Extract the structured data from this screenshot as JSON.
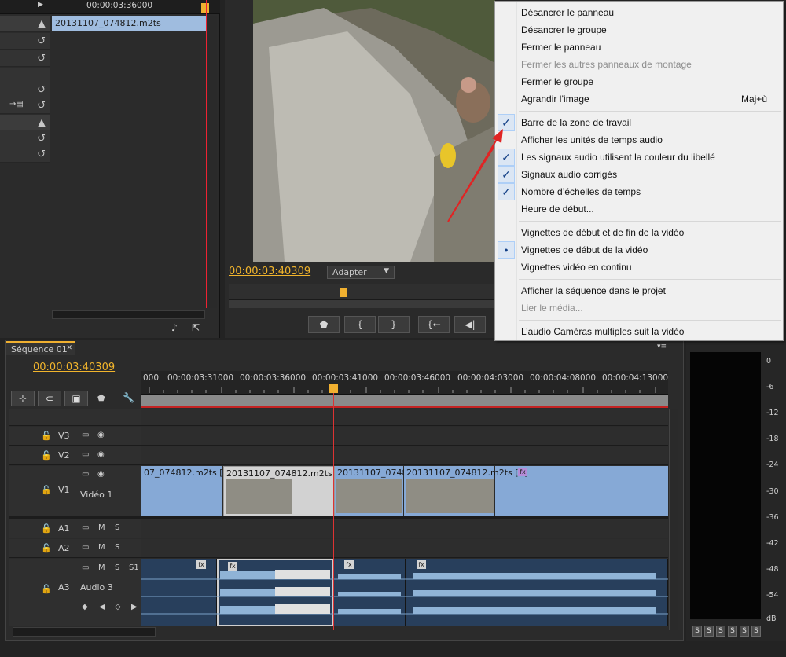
{
  "colors": {
    "accent_timecode": "#f2b52c",
    "video_clip": "#86a9d6",
    "audio_clip": "#283f5c",
    "playhead": "#dd3333"
  },
  "source_panel": {
    "ruler_tc": "00:00:03:36000",
    "clip_name": "20131107_074812.m2ts"
  },
  "program": {
    "timecode": "00:00:03:40309",
    "fit_value": "Adapter",
    "transport": [
      "marker",
      "in",
      "out",
      "go-to-in",
      "step-back"
    ]
  },
  "timeline": {
    "tab": "Séquence 01",
    "timecode": "00:00:03:40309",
    "ruler_labels": [
      "000",
      "00:00:03:31000",
      "00:00:03:36000",
      "00:00:03:41000",
      "00:00:03:46000",
      "00:00:04:03000",
      "00:00:04:08000",
      "00:00:04:13000"
    ],
    "tracks": {
      "v3": "V3",
      "v2": "V2",
      "v1": "V1",
      "v1_name": "Vidéo 1",
      "a1": "A1",
      "a2": "A2",
      "a3": "A3",
      "a3_name": "Audio 3",
      "mute": "M",
      "solo": "S",
      "submix": "S1"
    },
    "video_clips": [
      {
        "label": "07_074812.m2ts [V]"
      },
      {
        "label": "20131107_074812.m2ts [V]"
      },
      {
        "label": "20131107_07481"
      },
      {
        "label": "20131107_074812.m2ts [V]"
      }
    ],
    "fx": "fx"
  },
  "meter": {
    "db_labels": [
      "0",
      "-6",
      "-12",
      "-18",
      "-24",
      "-30",
      "-36",
      "-42",
      "-48",
      "-54",
      "dB"
    ],
    "solo_buttons": [
      "S",
      "S",
      "S",
      "S",
      "S",
      "S"
    ]
  },
  "context_menu": {
    "items": [
      {
        "label": "Désancrer le panneau"
      },
      {
        "label": "Désancrer le groupe"
      },
      {
        "label": "Fermer le panneau"
      },
      {
        "label": "Fermer les autres panneaux de montage",
        "disabled": true
      },
      {
        "label": "Fermer le groupe"
      },
      {
        "label": "Agrandir l’image",
        "shortcut": "Maj+ù"
      },
      {
        "label": "Barre de la zone de travail",
        "checked": true
      },
      {
        "label": "Afficher les unités de temps audio"
      },
      {
        "label": "Les signaux audio utilisent la couleur du libellé",
        "checked": true
      },
      {
        "label": "Signaux audio corrigés",
        "checked": true
      },
      {
        "label": "Nombre d’échelles de temps",
        "checked": true
      },
      {
        "label": "Heure de début..."
      },
      {
        "label": "Vignettes de début et de fin de la vidéo"
      },
      {
        "label": "Vignettes de début de la vidéo",
        "radio": true
      },
      {
        "label": "Vignettes vidéo en continu"
      },
      {
        "label": "Afficher la séquence dans le projet"
      },
      {
        "label": "Lier le média...",
        "disabled": true
      },
      {
        "label": "L’audio Caméras multiples suit la vidéo"
      }
    ],
    "check_glyph": "✓",
    "radio_glyph": "●"
  }
}
